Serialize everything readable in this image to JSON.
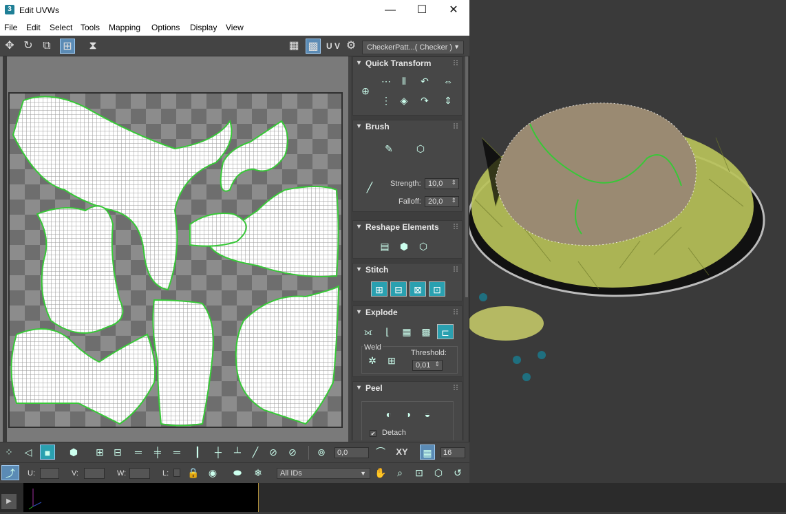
{
  "window": {
    "app_icon_text": "3",
    "title": "Edit UVWs",
    "minimize": "—",
    "maximize": "☐",
    "close": "✕"
  },
  "menu": [
    "File",
    "Edit",
    "Select",
    "Tools",
    "Mapping",
    "Options",
    "Display",
    "View"
  ],
  "toolbar": {
    "uv_label": "U V",
    "texture_dropdown": "CheckerPatt...( Checker )"
  },
  "panels": {
    "quick_transform": "Quick Transform",
    "brush": "Brush",
    "strength_label": "Strength:",
    "strength_value": "10,0",
    "falloff_label": "Falloff:",
    "falloff_value": "20,0",
    "reshape": "Reshape Elements",
    "stitch": "Stitch",
    "explode": "Explode",
    "weld_label": "Weld",
    "threshold_label": "Threshold:",
    "threshold_value": "0,01",
    "peel": "Peel",
    "detach_label": "Detach",
    "detach_checked": "✔"
  },
  "bottom": {
    "rotate_value": "0,0",
    "xy_label": "XY",
    "grid_value": "16",
    "u_label": "U:",
    "v_label": "V:",
    "w_label": "W:",
    "l_label": "L:",
    "ids_dropdown": "All IDs"
  },
  "colors": {
    "accent_teal": "#2aa0b0",
    "uv_seam": "#37c837",
    "mesh_yellow": "#c8c86a"
  }
}
